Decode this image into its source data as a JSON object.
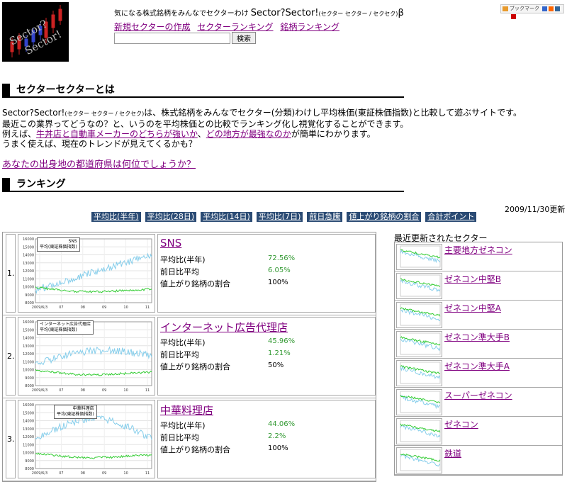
{
  "logo": {
    "line1": "Sector?",
    "line2": "Sector!"
  },
  "header": {
    "tagline_prefix": "気になる株式銘柄をみんなでセクターわけ",
    "tagline_name": "Sector?Sector!",
    "tagline_reading": "(セクター セクター / セクセク)",
    "tagline_beta": "β"
  },
  "bookmark_label": "ブックマーク",
  "nav": {
    "new_sector": "新規セクターの作成",
    "sector_ranking": "セクターランキング",
    "stock_ranking": "銘柄ランキング"
  },
  "search": {
    "value": "",
    "button": "検索"
  },
  "about": {
    "heading": "セクターセクターとは",
    "line1_a": "Sector?Sector!",
    "line1_b": "(セクター セクター / セクセク)",
    "line1_c": "は、株式銘柄をみんなでセクター(分類)わけし平均株価(東証株価指数)と比較して遊ぶサイトです。",
    "line2": "最近この業界ってどうなの？と、いうのを平均株価との比較でランキング化し視覚化することができます。",
    "line3_a": "例えば、",
    "line3_link1": "牛丼店と自動車メーカーのどちらが強いか",
    "line3_b": "、",
    "line3_link2": "どの地方が最強なのか",
    "line3_c": "が簡単にわかります。",
    "line4": "うまく使えば、現在のトレンドが見えてくるかも？",
    "pref_link": "あなたの出身地の都道府県は何位でしょうか？"
  },
  "ranking": {
    "heading": "ランキング",
    "updated": "2009/11/30更新",
    "tabs": [
      "平均比(半年)",
      "平均比(28日)",
      "平均比(14日)",
      "平均比(7日)",
      "前日急騰",
      "値上がり銘柄の割合",
      "合計ポイント"
    ],
    "metric_labels": {
      "avg_half_year": "平均比(半年)",
      "prev_day": "前日比平均",
      "rise_ratio": "値上がり銘柄の割合"
    },
    "rows": [
      {
        "rank": "1.",
        "name": "SNS",
        "avg_half_year": "72.56%",
        "prev_day": "6.05%",
        "rise_ratio": "100%",
        "legend_name": "SNS",
        "legend_index": "平均(東証株価指数)"
      },
      {
        "rank": "2.",
        "name": "インターネット広告代理店",
        "avg_half_year": "45.96%",
        "prev_day": "1.21%",
        "rise_ratio": "50%",
        "legend_name": "インターネット広告代理店",
        "legend_index": "平均(東証株価指数)"
      },
      {
        "rank": "3.",
        "name": "中華料理店",
        "avg_half_year": "44.06%",
        "prev_day": "2.2%",
        "rise_ratio": "100%",
        "legend_name": "中華料理店",
        "legend_index": "平均(東証株価指数)"
      }
    ],
    "chart_axis": {
      "y_ticks": [
        "16000",
        "15000",
        "14000",
        "13000",
        "12000",
        "11000",
        "10000",
        "9000",
        "8000"
      ],
      "x_ticks": [
        "2009/6/3",
        "07",
        "08",
        "09",
        "10",
        "11"
      ]
    }
  },
  "recent": {
    "heading": "最近更新されたセクター",
    "items": [
      "主要地方ゼネコン",
      "ゼネコン中堅B",
      "ゼネコン中堅A",
      "ゼネコン準大手B",
      "ゼネコン準大手A",
      "スーパーゼネコン",
      "ゼネコン",
      "鉄道"
    ]
  },
  "colors": {
    "tab_bg": "#2b4b74",
    "link": "#800080",
    "value_green": "#339933",
    "sector_line": "#87ceeb",
    "index_line": "#33cc33"
  }
}
